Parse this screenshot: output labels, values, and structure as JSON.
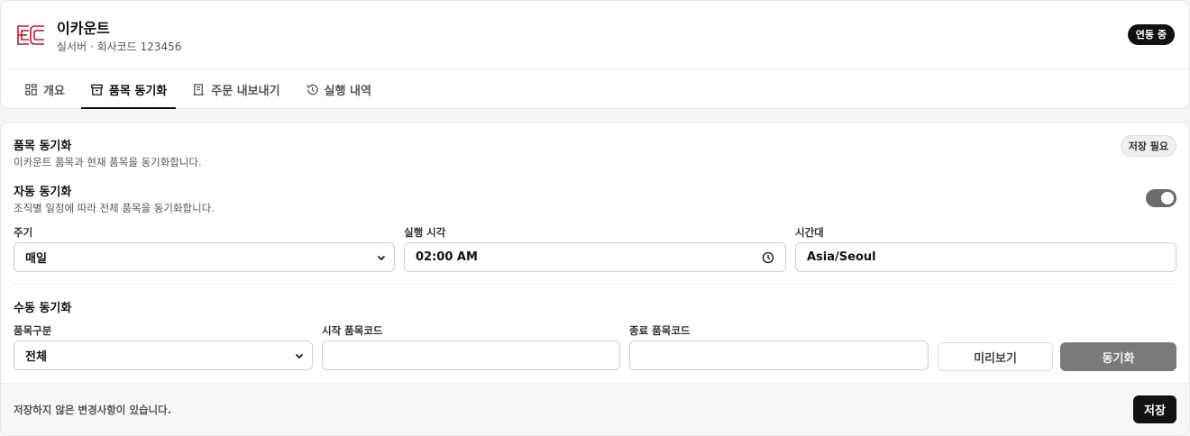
{
  "header": {
    "title": "이카운트",
    "subtitle": "실서버 · 회사코드 123456",
    "status_badge": "연동 중",
    "logo_text": "EC",
    "brand_color": "#c8102e"
  },
  "tabs": [
    {
      "label": "개요",
      "icon": "grid-icon"
    },
    {
      "label": "품목 동기화",
      "icon": "archive-box-icon",
      "active": true
    },
    {
      "label": "주문 내보내기",
      "icon": "receipt-icon"
    },
    {
      "label": "실행 내역",
      "icon": "history-icon"
    }
  ],
  "item_sync": {
    "title": "품목 동기화",
    "description": "이카운트 품목과 현재 품목을 동기화합니다.",
    "badge": "저장 필요"
  },
  "auto_sync": {
    "title": "자동 동기화",
    "description": "조직별 일정에 따라 전체 품목을 동기화합니다.",
    "enabled": true,
    "period_label": "주기",
    "period_value": "매일",
    "time_label": "실행 시각",
    "time_value": "02:00 AM",
    "tz_label": "시간대",
    "tz_value": "Asia/Seoul"
  },
  "manual_sync": {
    "title": "수동 동기화",
    "category_label": "품목구분",
    "category_value": "전체",
    "start_label": "시작 품목코드",
    "start_value": "",
    "end_label": "종료 품목코드",
    "end_value": "",
    "preview_button": "미리보기",
    "sync_button": "동기화"
  },
  "footer": {
    "message": "저장하지 않은 변경사항이 있습니다.",
    "save_button": "저장"
  }
}
